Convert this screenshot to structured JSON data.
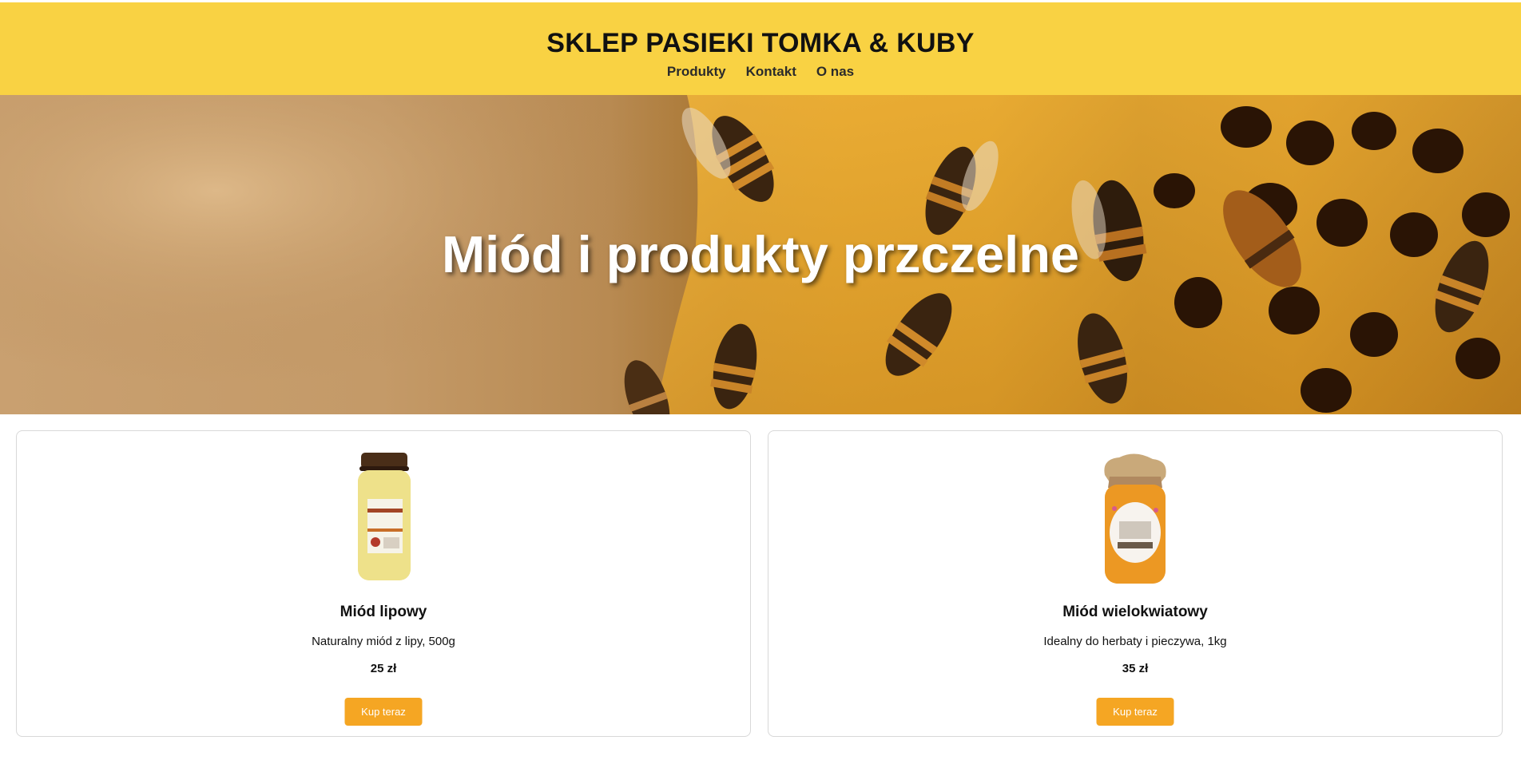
{
  "header": {
    "title": "SKLEP PASIEKI TOMKA & KUBY",
    "nav": [
      {
        "label": "Produkty"
      },
      {
        "label": "Kontakt"
      },
      {
        "label": "O nas"
      }
    ],
    "background_color": "#f9d243"
  },
  "hero": {
    "title": "Miód i produkty przczelne",
    "image": "bees-on-honeycomb-photo"
  },
  "products": [
    {
      "name": "Miód lipowy",
      "description": "Naturalny miód z lipy, 500g",
      "price": "25 zł",
      "button_label": "Kup teraz",
      "image": "linden-honey-jar"
    },
    {
      "name": "Miód wielokwiatowy",
      "description": "Idealny do herbaty i pieczywa, 1kg",
      "price": "35 zł",
      "button_label": "Kup teraz",
      "image": "multiflower-honey-jar"
    }
  ],
  "colors": {
    "accent": "#f5a623",
    "header": "#f9d243"
  }
}
